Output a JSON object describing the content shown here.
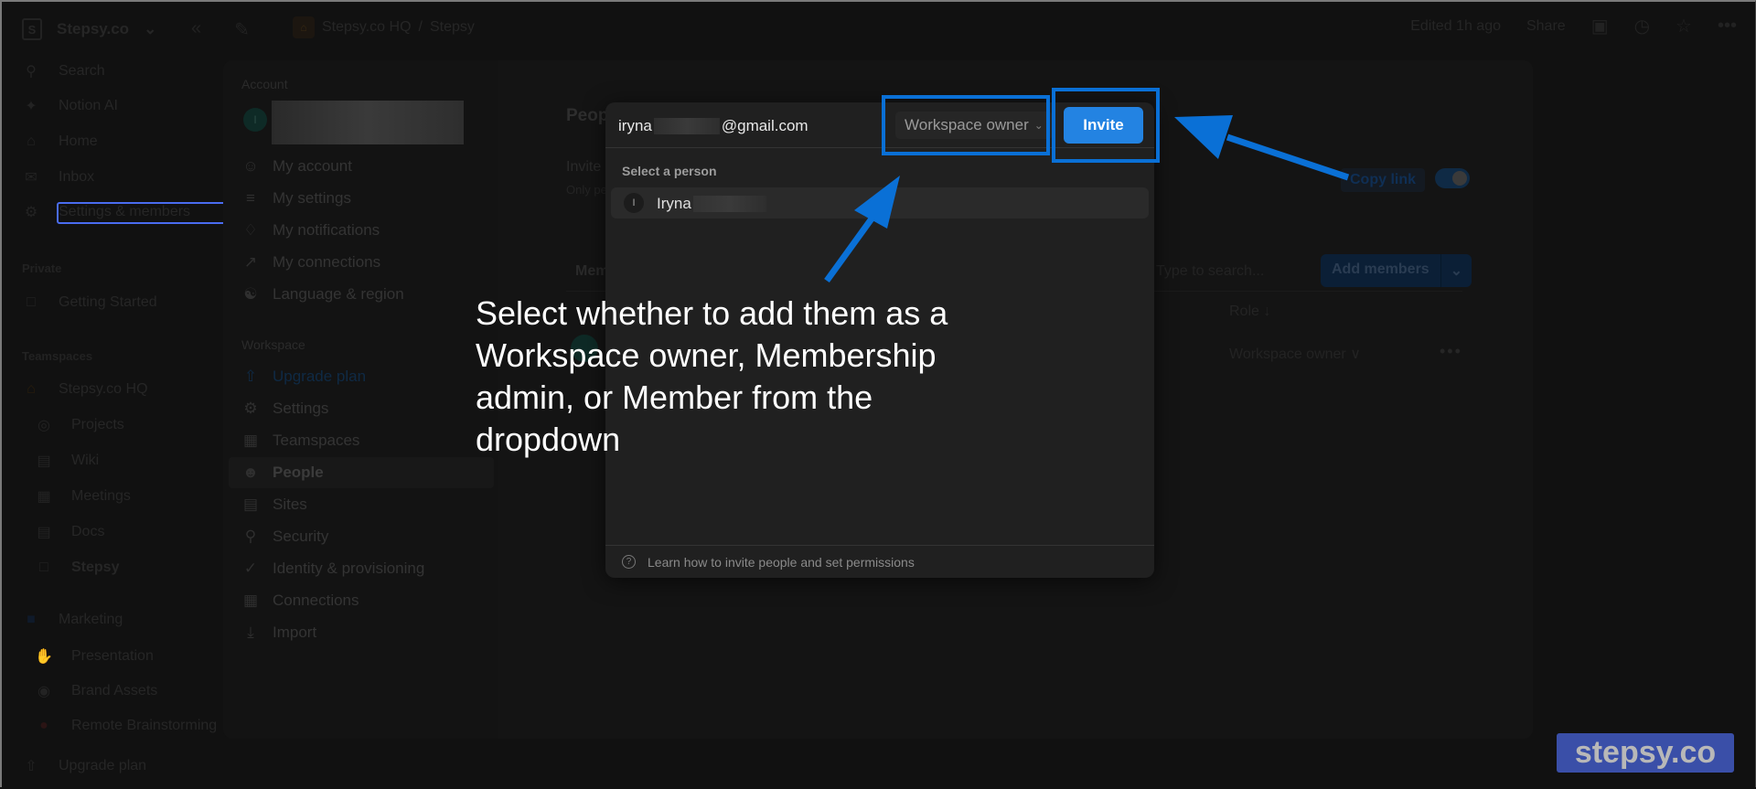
{
  "sidebar": {
    "workspace_name": "Stepsy.co",
    "workspace_initial": "S",
    "items": [
      {
        "icon": "search-icon",
        "label": "Search"
      },
      {
        "icon": "sparkle-icon",
        "label": "Notion AI"
      },
      {
        "icon": "home-icon",
        "label": "Home"
      },
      {
        "icon": "inbox-icon",
        "label": "Inbox"
      },
      {
        "icon": "gear-icon",
        "label": "Settings & members"
      }
    ],
    "private_label": "Private",
    "private_items": [
      {
        "icon": "page-icon",
        "label": "Getting Started"
      }
    ],
    "teamspaces_label": "Teamspaces",
    "teamspace_hq": "Stepsy.co HQ",
    "hq_items": [
      {
        "icon": "target-icon",
        "label": "Projects"
      },
      {
        "icon": "book-icon",
        "label": "Wiki"
      },
      {
        "icon": "calendar-icon",
        "label": "Meetings"
      },
      {
        "icon": "doc-icon",
        "label": "Docs"
      },
      {
        "icon": "page-icon",
        "label": "Stepsy"
      }
    ],
    "teamspace_marketing": "Marketing",
    "marketing_items": [
      {
        "icon": "clap-icon",
        "label": "Presentation"
      },
      {
        "icon": "palette-icon",
        "label": "Brand Assets"
      },
      {
        "icon": "bubble-icon",
        "label": "Remote Brainstorming"
      }
    ],
    "upgrade_label": "Upgrade plan"
  },
  "topbar": {
    "breadcrumb": [
      "Stepsy.co HQ",
      "Stepsy"
    ],
    "breadcrumb_sep": "/",
    "edited": "Edited 1h ago",
    "share": "Share"
  },
  "settings": {
    "account_section": "Account",
    "account_avatar_initial": "I",
    "account_items": [
      {
        "icon": "user-circle-icon",
        "label": "My account"
      },
      {
        "icon": "sliders-icon",
        "label": "My settings"
      },
      {
        "icon": "bell-icon",
        "label": "My notifications"
      },
      {
        "icon": "external-link-icon",
        "label": "My connections"
      },
      {
        "icon": "globe-icon",
        "label": "Language & region"
      }
    ],
    "workspace_section": "Workspace",
    "workspace_items": [
      {
        "icon": "upgrade-icon",
        "label": "Upgrade plan"
      },
      {
        "icon": "gear-icon",
        "label": "Settings"
      },
      {
        "icon": "building-icon",
        "label": "Teamspaces"
      },
      {
        "icon": "people-icon",
        "label": "People"
      },
      {
        "icon": "browser-icon",
        "label": "Sites"
      },
      {
        "icon": "key-icon",
        "label": "Security"
      },
      {
        "icon": "shield-check-icon",
        "label": "Identity & provisioning"
      },
      {
        "icon": "grid-icon",
        "label": "Connections"
      },
      {
        "icon": "download-icon",
        "label": "Import"
      }
    ],
    "people": {
      "title": "People",
      "invite_label": "Invite link",
      "invite_sub": "Only people with permission to invite members can see this.",
      "copy_link": "Copy link",
      "toggle_on": true,
      "tab_members": "Members",
      "search_placeholder": "Type to search...",
      "add_members": "Add members",
      "role_header": "Role ↓",
      "row_role": "Workspace owner ∨",
      "row_more": "•••"
    }
  },
  "invite_popup": {
    "email_prefix": "iryna",
    "email_suffix": "@gmail.com",
    "role_selected": "Workspace owner",
    "invite_button": "Invite",
    "select_person_label": "Select a person",
    "person_initial": "I",
    "person_name": "Iryna",
    "footer_help": "Learn how to invite people and set permissions"
  },
  "annotation": {
    "callout_text": "Select whether to add them as a Workspace owner, Membership admin, or Member from the dropdown",
    "accent_color": "#0a70d6"
  },
  "watermark": "stepsy.co"
}
